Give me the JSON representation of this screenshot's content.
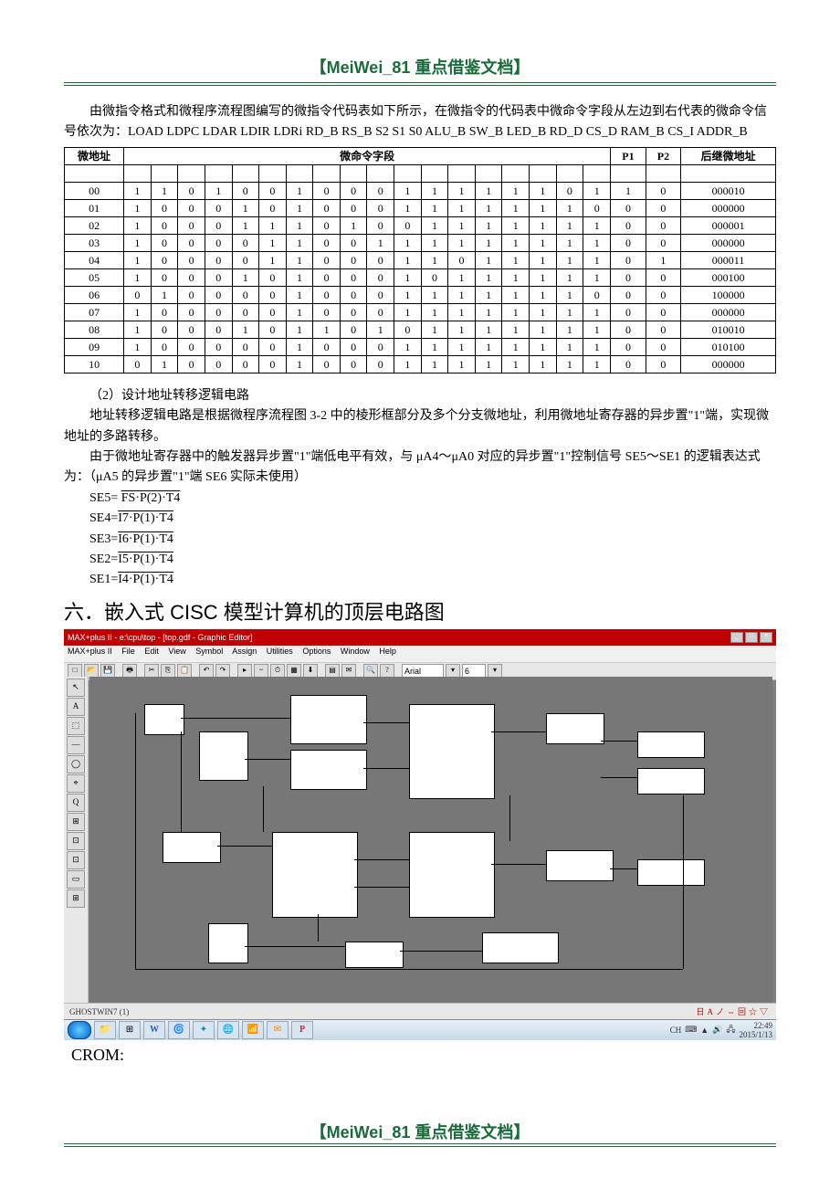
{
  "header": {
    "title": "【MeiWei_81 重点借鉴文档】"
  },
  "intro": {
    "p1": "由微指令格式和微程序流程图编写的微指令代码表如下所示，在微指令的代码表中微命令字段从左边到右代表的微命令信号依次为：LOAD LDPC LDAR LDIR LDRi RD_B RS_B S2 S1 S0 ALU_B SW_B LED_B RD_D CS_D RAM_B CS_I ADDR_B"
  },
  "table": {
    "headers": {
      "addr": "微地址",
      "cmd": "微命令字段",
      "p1": "P1",
      "p2": "P2",
      "next": "后继微地址"
    },
    "rows": [
      {
        "addr": "00",
        "bits": [
          "1",
          "1",
          "0",
          "1",
          "0",
          "0",
          "1",
          "0",
          "0",
          "0",
          "1",
          "1",
          "1",
          "1",
          "1",
          "1",
          "0",
          "1"
        ],
        "p1": "1",
        "p2": "0",
        "next": "000010"
      },
      {
        "addr": "01",
        "bits": [
          "1",
          "0",
          "0",
          "0",
          "1",
          "0",
          "1",
          "0",
          "0",
          "0",
          "1",
          "1",
          "1",
          "1",
          "1",
          "1",
          "1",
          "0"
        ],
        "p1": "0",
        "p2": "0",
        "next": "000000"
      },
      {
        "addr": "02",
        "bits": [
          "1",
          "0",
          "0",
          "0",
          "1",
          "1",
          "1",
          "0",
          "1",
          "0",
          "0",
          "1",
          "1",
          "1",
          "1",
          "1",
          "1",
          "1"
        ],
        "p1": "0",
        "p2": "0",
        "next": "000001"
      },
      {
        "addr": "03",
        "bits": [
          "1",
          "0",
          "0",
          "0",
          "0",
          "1",
          "1",
          "0",
          "0",
          "1",
          "1",
          "1",
          "1",
          "1",
          "1",
          "1",
          "1",
          "1"
        ],
        "p1": "0",
        "p2": "0",
        "next": "000000"
      },
      {
        "addr": "04",
        "bits": [
          "1",
          "0",
          "0",
          "0",
          "0",
          "1",
          "1",
          "0",
          "0",
          "0",
          "1",
          "1",
          "0",
          "1",
          "1",
          "1",
          "1",
          "1"
        ],
        "p1": "0",
        "p2": "1",
        "next": "000011"
      },
      {
        "addr": "05",
        "bits": [
          "1",
          "0",
          "0",
          "0",
          "1",
          "0",
          "1",
          "0",
          "0",
          "0",
          "1",
          "0",
          "1",
          "1",
          "1",
          "1",
          "1",
          "1"
        ],
        "p1": "0",
        "p2": "0",
        "next": "000100"
      },
      {
        "addr": "06",
        "bits": [
          "0",
          "1",
          "0",
          "0",
          "0",
          "0",
          "1",
          "0",
          "0",
          "0",
          "1",
          "1",
          "1",
          "1",
          "1",
          "1",
          "1",
          "0"
        ],
        "p1": "0",
        "p2": "0",
        "next": "100000"
      },
      {
        "addr": "07",
        "bits": [
          "1",
          "0",
          "0",
          "0",
          "0",
          "0",
          "1",
          "0",
          "0",
          "0",
          "1",
          "1",
          "1",
          "1",
          "1",
          "1",
          "1",
          "1"
        ],
        "p1": "0",
        "p2": "0",
        "next": "000000"
      },
      {
        "addr": "08",
        "bits": [
          "1",
          "0",
          "0",
          "0",
          "1",
          "0",
          "1",
          "1",
          "0",
          "1",
          "0",
          "1",
          "1",
          "1",
          "1",
          "1",
          "1",
          "1"
        ],
        "p1": "0",
        "p2": "0",
        "next": "010010"
      },
      {
        "addr": "09",
        "bits": [
          "1",
          "0",
          "0",
          "0",
          "0",
          "0",
          "1",
          "0",
          "0",
          "0",
          "1",
          "1",
          "1",
          "1",
          "1",
          "1",
          "1",
          "1"
        ],
        "p1": "0",
        "p2": "0",
        "next": "010100"
      },
      {
        "addr": "10",
        "bits": [
          "0",
          "1",
          "0",
          "0",
          "0",
          "0",
          "1",
          "0",
          "0",
          "0",
          "1",
          "1",
          "1",
          "1",
          "1",
          "1",
          "1",
          "1"
        ],
        "p1": "0",
        "p2": "0",
        "next": "000000"
      }
    ]
  },
  "section2": {
    "title": "（2）设计地址转移逻辑电路",
    "p1": "地址转移逻辑电路是根据微程序流程图 3-2 中的棱形框部分及多个分支微地址，利用微地址寄存器的异步置\"1\"端，实现微地址的多路转移。",
    "p2": "由于微地址寄存器中的触发器异步置\"1\"端低电平有效，与 μA4～μA0 对应的异步置\"1\"控制信号 SE5～SE1 的逻辑表达式为：（μA5 的异步置\"1\"端 SE6 实际未使用）",
    "formulas": {
      "se5_lhs": "SE5= ",
      "se5_rhs": "FS·P(2)·T4",
      "se4_lhs": "SE4=",
      "se4_rhs": "I7·P(1)·T4",
      "se3_lhs": "SE3=",
      "se3_rhs": "I6·P(1)·T4",
      "se2_lhs": "SE2=",
      "se2_rhs": "I5·P(1)·T4",
      "se1_lhs": "SE1=",
      "se1_rhs": "I4·P(1)·T4"
    }
  },
  "heading6": "六．嵌入式 CISC 模型计算机的顶层电路图",
  "app": {
    "title": "MAX+plus II - e:\\cpu\\top - [top.gdf - Graphic Editor]",
    "menu": [
      "MAX+plus II",
      "File",
      "Edit",
      "View",
      "Symbol",
      "Assign",
      "Utilities",
      "Options",
      "Window",
      "Help"
    ],
    "font_box": "Arial",
    "size_box": "6",
    "status_left": "GHOSTWIN7 (1)",
    "status_right_icons": "日Aノ⇔回☆▽",
    "tray_net": "CH",
    "tray_kb": "⌨",
    "tray_time": "22:49",
    "tray_date": "2015/1/13"
  },
  "side_tools": [
    "↖",
    "A",
    "⬚",
    "—",
    "◯",
    "⌖",
    "Q",
    "⊞",
    "⊡",
    "⊡",
    "▭",
    "⊞"
  ],
  "task_icons": [
    "📁",
    "⊞",
    "W",
    "🌀",
    "✦",
    "🌐",
    "📶",
    "✉",
    "P"
  ],
  "crom_label": "CROM:",
  "footer": {
    "title": "【MeiWei_81 重点借鉴文档】"
  }
}
